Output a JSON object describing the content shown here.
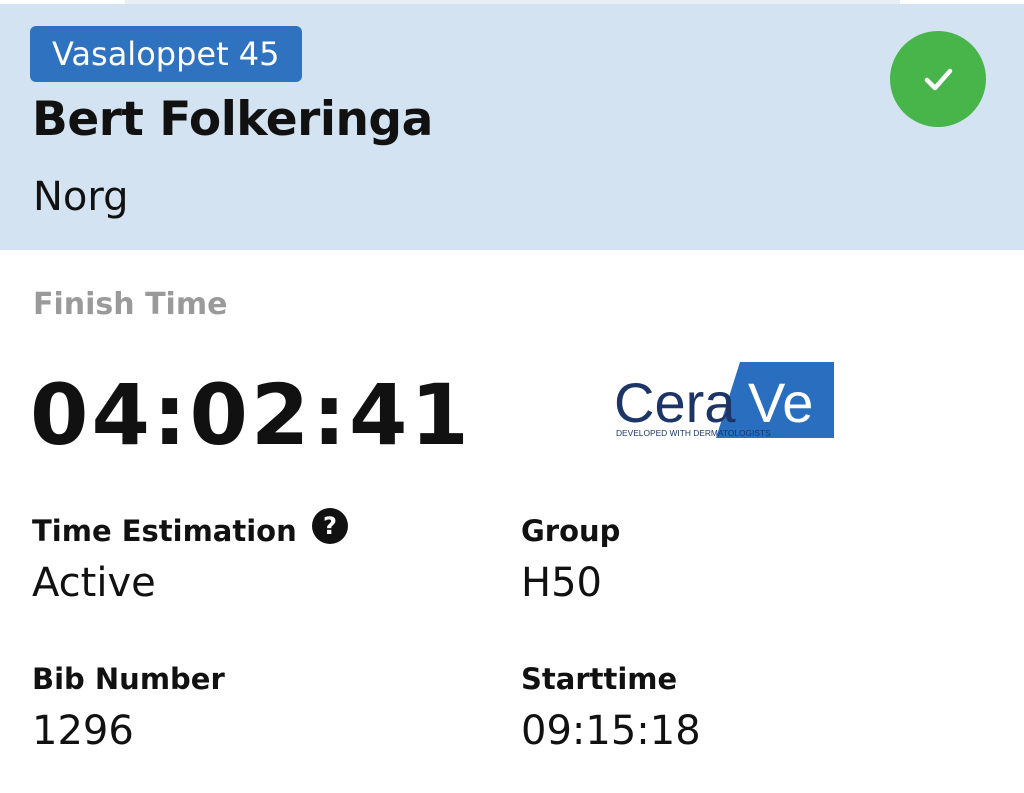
{
  "header": {
    "race_badge": "Vasaloppet 45",
    "athlete_name": "Bert Folkeringa",
    "country": "Norg",
    "status_icon": "check-icon",
    "colors": {
      "header_bg": "#d3e3f2",
      "badge_bg": "#2f73c0",
      "status_green": "#47b54a"
    }
  },
  "result": {
    "finish_label": "Finish Time",
    "finish_time": "04:02:41"
  },
  "sponsor": {
    "logo_text_left": "Cera",
    "logo_text_right": "Ve",
    "tagline": "DEVELOPED WITH DERMATOLOGISTS",
    "colors": {
      "navy": "#1c3566",
      "blue": "#2a6ec0"
    }
  },
  "fields": {
    "time_estimation": {
      "label": "Time Estimation",
      "value": "Active",
      "help_glyph": "?"
    },
    "group": {
      "label": "Group",
      "value": "H50"
    },
    "bib_number": {
      "label": "Bib Number",
      "value": "1296"
    },
    "starttime": {
      "label": "Starttime",
      "value": "09:15:18"
    }
  }
}
